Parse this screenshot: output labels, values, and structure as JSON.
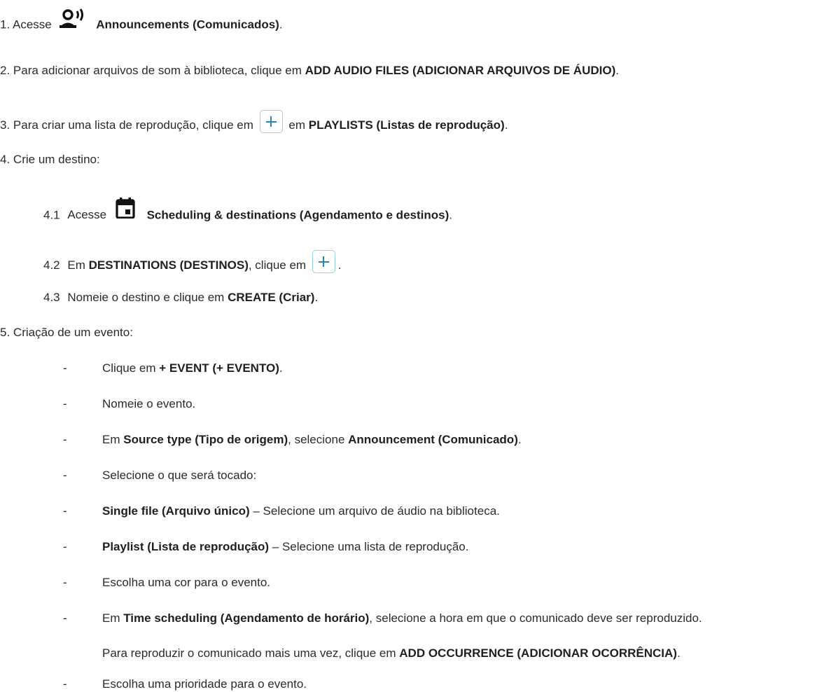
{
  "steps": [
    {
      "num": "1.",
      "pre": "Acesse",
      "bold": "Announcements (Comunicados)",
      "post": "."
    },
    {
      "num": "2.",
      "pre": "Para adicionar arquivos de som à biblioteca, clique em",
      "bold": "ADD AUDIO FILES (ADICIONAR ARQUIVOS DE ÁUDIO)",
      "post": "."
    },
    {
      "num": "3.",
      "pre": "Para criar uma lista de reprodução, clique em",
      "mid": "em",
      "bold": "PLAYLISTS (Listas de reprodução)",
      "post": "."
    },
    {
      "num": "4.",
      "text": "Crie um destino:"
    },
    {
      "num": "5.",
      "text": "Criação de um evento:"
    }
  ],
  "substeps": [
    {
      "num": "4.1",
      "pre": "Acesse",
      "bold": "Scheduling & destinations (Agendamento e destinos)",
      "post": "."
    },
    {
      "num": "4.2",
      "pre": "Em",
      "bold": "DESTINATIONS (DESTINOS)",
      "mid": ", clique em",
      "post": "."
    },
    {
      "num": "4.3",
      "pre": "Nomeie o destino e clique em",
      "bold": "CREATE (Criar)",
      "post": "."
    }
  ],
  "bullets": [
    {
      "dash": "-",
      "pre": "Clique em",
      "bold": "+ EVENT (+ EVENTO)",
      "post": "."
    },
    {
      "dash": "-",
      "text": "Nomeie o evento."
    },
    {
      "dash": "-",
      "pre": "Em",
      "bold": "Source type (Tipo de origem)",
      "mid": ", selecione",
      "bold2": "Announcement (Comunicado)",
      "post": "."
    },
    {
      "dash": "-",
      "text": "Selecione o que será tocado:"
    },
    {
      "dash": "-",
      "bold": "Single file (Arquivo único)",
      "post": " – Selecione um arquivo de áudio na biblioteca."
    },
    {
      "dash": "-",
      "bold": "Playlist (Lista de reprodução)",
      "post": " – Selecione uma lista de reprodução."
    },
    {
      "dash": "-",
      "text": "Escolha uma cor para o evento."
    },
    {
      "dash": "-",
      "pre": "Em",
      "bold": "Time scheduling (Agendamento de horário)",
      "post": ", selecione a hora em que o comunicado deve ser reproduzido."
    },
    {
      "pre": "Para reproduzir o comunicado mais uma vez, clique em",
      "bold": "ADD OCCURRENCE (ADICIONAR OCORRÊNCIA)",
      "post": "."
    },
    {
      "dash": "-",
      "text": "Escolha uma prioridade para o evento."
    }
  ],
  "icons": {
    "announcements": "announcement-speaker-icon",
    "scheduling": "calendar-icon",
    "add": "plus-button-icon",
    "accent": "#2a86b0"
  }
}
